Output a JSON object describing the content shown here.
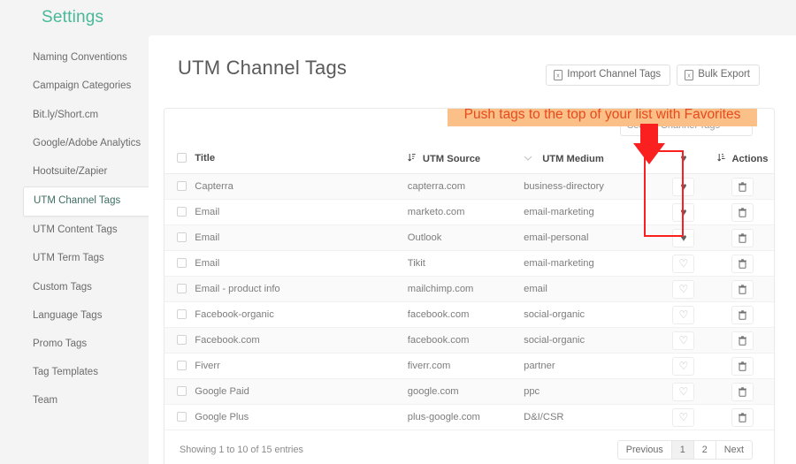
{
  "sidebar": {
    "brand": "Settings",
    "items": [
      {
        "label": "Naming Conventions",
        "active": false
      },
      {
        "label": "Campaign Categories",
        "active": false
      },
      {
        "label": "Bit.ly/Short.cm",
        "active": false
      },
      {
        "label": "Google/Adobe Analytics",
        "active": false
      },
      {
        "label": "Hootsuite/Zapier",
        "active": false
      },
      {
        "label": "UTM Channel Tags",
        "active": true
      },
      {
        "label": "UTM Content Tags",
        "active": false
      },
      {
        "label": "UTM Term Tags",
        "active": false
      },
      {
        "label": "Custom Tags",
        "active": false
      },
      {
        "label": "Language Tags",
        "active": false
      },
      {
        "label": "Promo Tags",
        "active": false
      },
      {
        "label": "Tag Templates",
        "active": false
      },
      {
        "label": "Team",
        "active": false
      }
    ]
  },
  "header": {
    "title": "UTM Channel Tags",
    "import_label": "Import Channel Tags",
    "export_label": "Bulk Export"
  },
  "annotation": {
    "banner_text": "Push tags to the top of your list with Favorites",
    "banner_bg": "#fac088",
    "banner_color": "#e8491d",
    "arrow_color": "#fa2020",
    "highlight_color": "#fa2020"
  },
  "search": {
    "value": "",
    "placeholder": "Search Channel Tags"
  },
  "table": {
    "columns": [
      {
        "key": "check",
        "label": ""
      },
      {
        "key": "title",
        "label": "Title"
      },
      {
        "key": "source",
        "label": "UTM Source"
      },
      {
        "key": "medium",
        "label": "UTM Medium"
      },
      {
        "key": "fav",
        "label": "heart-icon"
      },
      {
        "key": "act",
        "label": "Actions"
      }
    ],
    "rows": [
      {
        "title": "Capterra",
        "source": "capterra.com",
        "medium": "business-directory",
        "favorite": true,
        "checked": false
      },
      {
        "title": "Email",
        "source": "marketo.com",
        "medium": "email-marketing",
        "favorite": true,
        "checked": false
      },
      {
        "title": "Email",
        "source": "Outlook",
        "medium": "email-personal",
        "favorite": true,
        "checked": false
      },
      {
        "title": "Email",
        "source": "Tikit",
        "medium": "email-marketing",
        "favorite": false,
        "checked": false
      },
      {
        "title": "Email - product info",
        "source": "mailchimp.com",
        "medium": "email",
        "favorite": false,
        "checked": false
      },
      {
        "title": "Facebook-organic",
        "source": "facebook.com",
        "medium": "social-organic",
        "favorite": false,
        "checked": false
      },
      {
        "title": "Facebook.com",
        "source": "facebook.com",
        "medium": "social-organic",
        "favorite": false,
        "checked": false
      },
      {
        "title": "Fiverr",
        "source": "fiverr.com",
        "medium": "partner",
        "favorite": false,
        "checked": false
      },
      {
        "title": "Google Paid",
        "source": "google.com",
        "medium": "ppc",
        "favorite": false,
        "checked": false
      },
      {
        "title": "Google Plus",
        "source": "plus-google.com",
        "medium": "D&I/CSR",
        "favorite": false,
        "checked": false
      }
    ]
  },
  "footer": {
    "showing": "Showing 1 to 10 of 15 entries",
    "pager": [
      {
        "label": "Previous",
        "active": false
      },
      {
        "label": "1",
        "active": true
      },
      {
        "label": "2",
        "active": false
      },
      {
        "label": "Next",
        "active": false
      }
    ]
  },
  "theme": {
    "brand_color": "#49b89a",
    "page_bg": "#f4f4f4",
    "panel_bg": "#ffffff"
  }
}
